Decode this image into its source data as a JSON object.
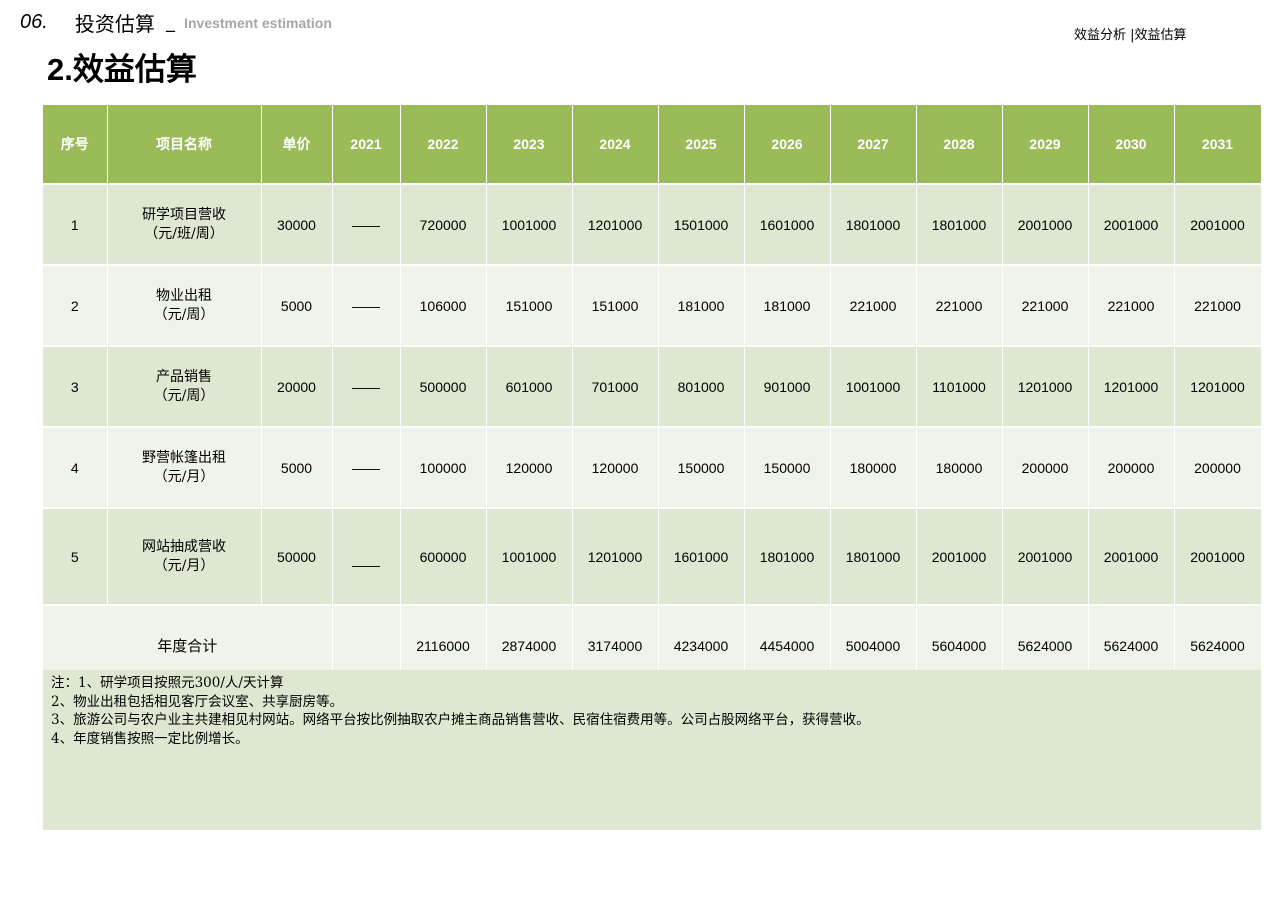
{
  "header": {
    "number": "06.",
    "title": "投资估算",
    "separator": "_",
    "subtitle_en": "Investment estimation",
    "breadcrumb": "效益分析 |效益估算"
  },
  "section_title": {
    "num": "2.",
    "text": "效益估算"
  },
  "table": {
    "columns": [
      "序号",
      "项目名称",
      "单价",
      "2021",
      "2022",
      "2023",
      "2024",
      "2025",
      "2026",
      "2027",
      "2028",
      "2029",
      "2030",
      "2031"
    ],
    "rows": [
      {
        "no": "1",
        "name1": "研学项目营收",
        "name2": "（元/班/周）",
        "price": "30000",
        "y2021": "——",
        "vals": [
          "720000",
          "1001000",
          "1201000",
          "1501000",
          "1601000",
          "1801000",
          "1801000",
          "2001000",
          "2001000",
          "2001000"
        ]
      },
      {
        "no": "2",
        "name1": "物业出租",
        "name2": "（元/周）",
        "price": "5000",
        "y2021": "——",
        "vals": [
          "106000",
          "151000",
          "151000",
          "181000",
          "181000",
          "221000",
          "221000",
          "221000",
          "221000",
          "221000"
        ]
      },
      {
        "no": "3",
        "name1": "产品销售",
        "name2": "（元/周）",
        "price": "20000",
        "y2021": "——",
        "vals": [
          "500000",
          "601000",
          "701000",
          "801000",
          "901000",
          "1001000",
          "1101000",
          "1201000",
          "1201000",
          "1201000"
        ]
      },
      {
        "no": "4",
        "name1": "野营帐篷出租",
        "name2": "（元/月）",
        "price": "5000",
        "y2021": "——",
        "vals": [
          "100000",
          "120000",
          "120000",
          "150000",
          "150000",
          "180000",
          "180000",
          "200000",
          "200000",
          "200000"
        ]
      },
      {
        "no": "5",
        "name1": "网站抽成营收",
        "name2": "（元/月）",
        "price": "50000",
        "y2021": "——",
        "vals": [
          "600000",
          "1001000",
          "1201000",
          "1601000",
          "1801000",
          "1801000",
          "2001000",
          "2001000",
          "2001000",
          "2001000"
        ]
      }
    ],
    "total": {
      "label": "年度合计",
      "vals": [
        "2116000",
        "2874000",
        "3174000",
        "4234000",
        "4454000",
        "5004000",
        "5604000",
        "5624000",
        "5624000",
        "5624000"
      ]
    }
  },
  "notes": [
    "注：1、研学项目按照元300/人/天计算",
    "2、物业出租包括相见客厅会议室、共享厨房等。",
    "3、旅游公司与农户业主共建相见村网站。网络平台按比例抽取农户摊主商品销售营收、民宿住宿费用等。公司占股网络平台，获得营收。",
    "4、年度销售按照一定比例增长。"
  ]
}
